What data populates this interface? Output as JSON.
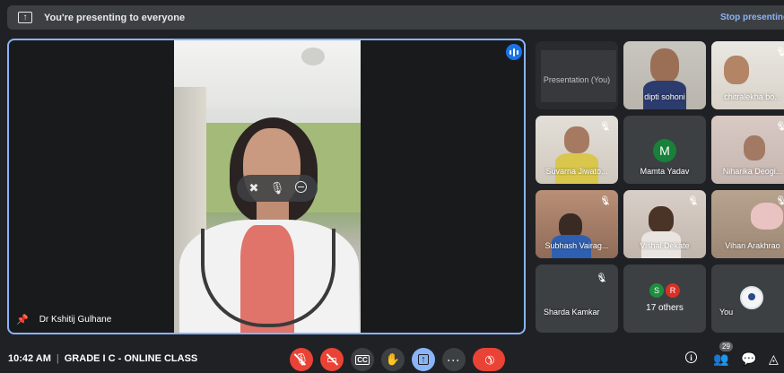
{
  "presenting_bar": {
    "message": "You're presenting to everyone",
    "stop_label": "Stop presenting"
  },
  "main_speaker": {
    "name": "Dr Kshitij Gulhane"
  },
  "participants": [
    {
      "id": "presentation",
      "label": "Presentation (You)"
    },
    {
      "id": "dipti",
      "label": "dipti sohoni"
    },
    {
      "id": "chitralekha",
      "label": "chitralekha bo..."
    },
    {
      "id": "suvarna",
      "label": "Suvarna Jiwato..."
    },
    {
      "id": "mamta",
      "label": "Mamta Yadav",
      "initial": "M"
    },
    {
      "id": "niharika",
      "label": "Niharika Deogi..."
    },
    {
      "id": "subhash",
      "label": "Subhash Vairag..."
    },
    {
      "id": "vishal",
      "label": "Vishal Dekate"
    },
    {
      "id": "vihan",
      "label": "Vihan Arakhrao"
    },
    {
      "id": "sharda",
      "label": "Sharda Kamkar"
    },
    {
      "id": "others",
      "label": "17 others",
      "initials": [
        "S",
        "R"
      ]
    },
    {
      "id": "you",
      "label": "You"
    }
  ],
  "bottom_bar": {
    "time": "10:42 AM",
    "meeting_name": "GRADE I C - ONLINE CLASS",
    "participant_count": "29"
  },
  "colors": {
    "accent": "#8ab4f8",
    "danger": "#ea4335",
    "tile": "#3c4043",
    "background": "#202124",
    "avatar_m": "#188038",
    "avatar_s": "#1e8e3e",
    "avatar_r": "#d93025"
  },
  "icons": [
    "present-screen-icon",
    "speaking-icon",
    "pin-icon",
    "mute-mic-icon",
    "mic-icon",
    "remove-icon",
    "mic-off-icon",
    "camera-off-icon",
    "captions-icon",
    "raise-hand-icon",
    "present-icon",
    "more-options-icon",
    "end-call-icon",
    "info-icon",
    "people-icon",
    "chat-icon",
    "activities-icon"
  ]
}
